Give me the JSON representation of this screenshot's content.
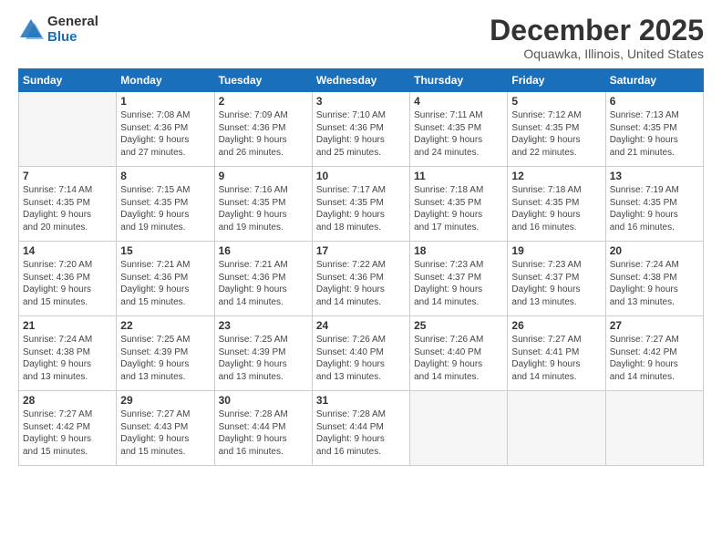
{
  "logo": {
    "general": "General",
    "blue": "Blue"
  },
  "title": "December 2025",
  "subtitle": "Oquawka, Illinois, United States",
  "days_of_week": [
    "Sunday",
    "Monday",
    "Tuesday",
    "Wednesday",
    "Thursday",
    "Friday",
    "Saturday"
  ],
  "weeks": [
    [
      {
        "day": "",
        "sunrise": "",
        "sunset": "",
        "daylight": ""
      },
      {
        "day": "1",
        "sunrise": "Sunrise: 7:08 AM",
        "sunset": "Sunset: 4:36 PM",
        "daylight": "Daylight: 9 hours and 27 minutes."
      },
      {
        "day": "2",
        "sunrise": "Sunrise: 7:09 AM",
        "sunset": "Sunset: 4:36 PM",
        "daylight": "Daylight: 9 hours and 26 minutes."
      },
      {
        "day": "3",
        "sunrise": "Sunrise: 7:10 AM",
        "sunset": "Sunset: 4:36 PM",
        "daylight": "Daylight: 9 hours and 25 minutes."
      },
      {
        "day": "4",
        "sunrise": "Sunrise: 7:11 AM",
        "sunset": "Sunset: 4:35 PM",
        "daylight": "Daylight: 9 hours and 24 minutes."
      },
      {
        "day": "5",
        "sunrise": "Sunrise: 7:12 AM",
        "sunset": "Sunset: 4:35 PM",
        "daylight": "Daylight: 9 hours and 22 minutes."
      },
      {
        "day": "6",
        "sunrise": "Sunrise: 7:13 AM",
        "sunset": "Sunset: 4:35 PM",
        "daylight": "Daylight: 9 hours and 21 minutes."
      }
    ],
    [
      {
        "day": "7",
        "sunrise": "Sunrise: 7:14 AM",
        "sunset": "Sunset: 4:35 PM",
        "daylight": "Daylight: 9 hours and 20 minutes."
      },
      {
        "day": "8",
        "sunrise": "Sunrise: 7:15 AM",
        "sunset": "Sunset: 4:35 PM",
        "daylight": "Daylight: 9 hours and 19 minutes."
      },
      {
        "day": "9",
        "sunrise": "Sunrise: 7:16 AM",
        "sunset": "Sunset: 4:35 PM",
        "daylight": "Daylight: 9 hours and 19 minutes."
      },
      {
        "day": "10",
        "sunrise": "Sunrise: 7:17 AM",
        "sunset": "Sunset: 4:35 PM",
        "daylight": "Daylight: 9 hours and 18 minutes."
      },
      {
        "day": "11",
        "sunrise": "Sunrise: 7:18 AM",
        "sunset": "Sunset: 4:35 PM",
        "daylight": "Daylight: 9 hours and 17 minutes."
      },
      {
        "day": "12",
        "sunrise": "Sunrise: 7:18 AM",
        "sunset": "Sunset: 4:35 PM",
        "daylight": "Daylight: 9 hours and 16 minutes."
      },
      {
        "day": "13",
        "sunrise": "Sunrise: 7:19 AM",
        "sunset": "Sunset: 4:35 PM",
        "daylight": "Daylight: 9 hours and 16 minutes."
      }
    ],
    [
      {
        "day": "14",
        "sunrise": "Sunrise: 7:20 AM",
        "sunset": "Sunset: 4:36 PM",
        "daylight": "Daylight: 9 hours and 15 minutes."
      },
      {
        "day": "15",
        "sunrise": "Sunrise: 7:21 AM",
        "sunset": "Sunset: 4:36 PM",
        "daylight": "Daylight: 9 hours and 15 minutes."
      },
      {
        "day": "16",
        "sunrise": "Sunrise: 7:21 AM",
        "sunset": "Sunset: 4:36 PM",
        "daylight": "Daylight: 9 hours and 14 minutes."
      },
      {
        "day": "17",
        "sunrise": "Sunrise: 7:22 AM",
        "sunset": "Sunset: 4:36 PM",
        "daylight": "Daylight: 9 hours and 14 minutes."
      },
      {
        "day": "18",
        "sunrise": "Sunrise: 7:23 AM",
        "sunset": "Sunset: 4:37 PM",
        "daylight": "Daylight: 9 hours and 14 minutes."
      },
      {
        "day": "19",
        "sunrise": "Sunrise: 7:23 AM",
        "sunset": "Sunset: 4:37 PM",
        "daylight": "Daylight: 9 hours and 13 minutes."
      },
      {
        "day": "20",
        "sunrise": "Sunrise: 7:24 AM",
        "sunset": "Sunset: 4:38 PM",
        "daylight": "Daylight: 9 hours and 13 minutes."
      }
    ],
    [
      {
        "day": "21",
        "sunrise": "Sunrise: 7:24 AM",
        "sunset": "Sunset: 4:38 PM",
        "daylight": "Daylight: 9 hours and 13 minutes."
      },
      {
        "day": "22",
        "sunrise": "Sunrise: 7:25 AM",
        "sunset": "Sunset: 4:39 PM",
        "daylight": "Daylight: 9 hours and 13 minutes."
      },
      {
        "day": "23",
        "sunrise": "Sunrise: 7:25 AM",
        "sunset": "Sunset: 4:39 PM",
        "daylight": "Daylight: 9 hours and 13 minutes."
      },
      {
        "day": "24",
        "sunrise": "Sunrise: 7:26 AM",
        "sunset": "Sunset: 4:40 PM",
        "daylight": "Daylight: 9 hours and 13 minutes."
      },
      {
        "day": "25",
        "sunrise": "Sunrise: 7:26 AM",
        "sunset": "Sunset: 4:40 PM",
        "daylight": "Daylight: 9 hours and 14 minutes."
      },
      {
        "day": "26",
        "sunrise": "Sunrise: 7:27 AM",
        "sunset": "Sunset: 4:41 PM",
        "daylight": "Daylight: 9 hours and 14 minutes."
      },
      {
        "day": "27",
        "sunrise": "Sunrise: 7:27 AM",
        "sunset": "Sunset: 4:42 PM",
        "daylight": "Daylight: 9 hours and 14 minutes."
      }
    ],
    [
      {
        "day": "28",
        "sunrise": "Sunrise: 7:27 AM",
        "sunset": "Sunset: 4:42 PM",
        "daylight": "Daylight: 9 hours and 15 minutes."
      },
      {
        "day": "29",
        "sunrise": "Sunrise: 7:27 AM",
        "sunset": "Sunset: 4:43 PM",
        "daylight": "Daylight: 9 hours and 15 minutes."
      },
      {
        "day": "30",
        "sunrise": "Sunrise: 7:28 AM",
        "sunset": "Sunset: 4:44 PM",
        "daylight": "Daylight: 9 hours and 16 minutes."
      },
      {
        "day": "31",
        "sunrise": "Sunrise: 7:28 AM",
        "sunset": "Sunset: 4:44 PM",
        "daylight": "Daylight: 9 hours and 16 minutes."
      },
      {
        "day": "",
        "sunrise": "",
        "sunset": "",
        "daylight": ""
      },
      {
        "day": "",
        "sunrise": "",
        "sunset": "",
        "daylight": ""
      },
      {
        "day": "",
        "sunrise": "",
        "sunset": "",
        "daylight": ""
      }
    ]
  ]
}
